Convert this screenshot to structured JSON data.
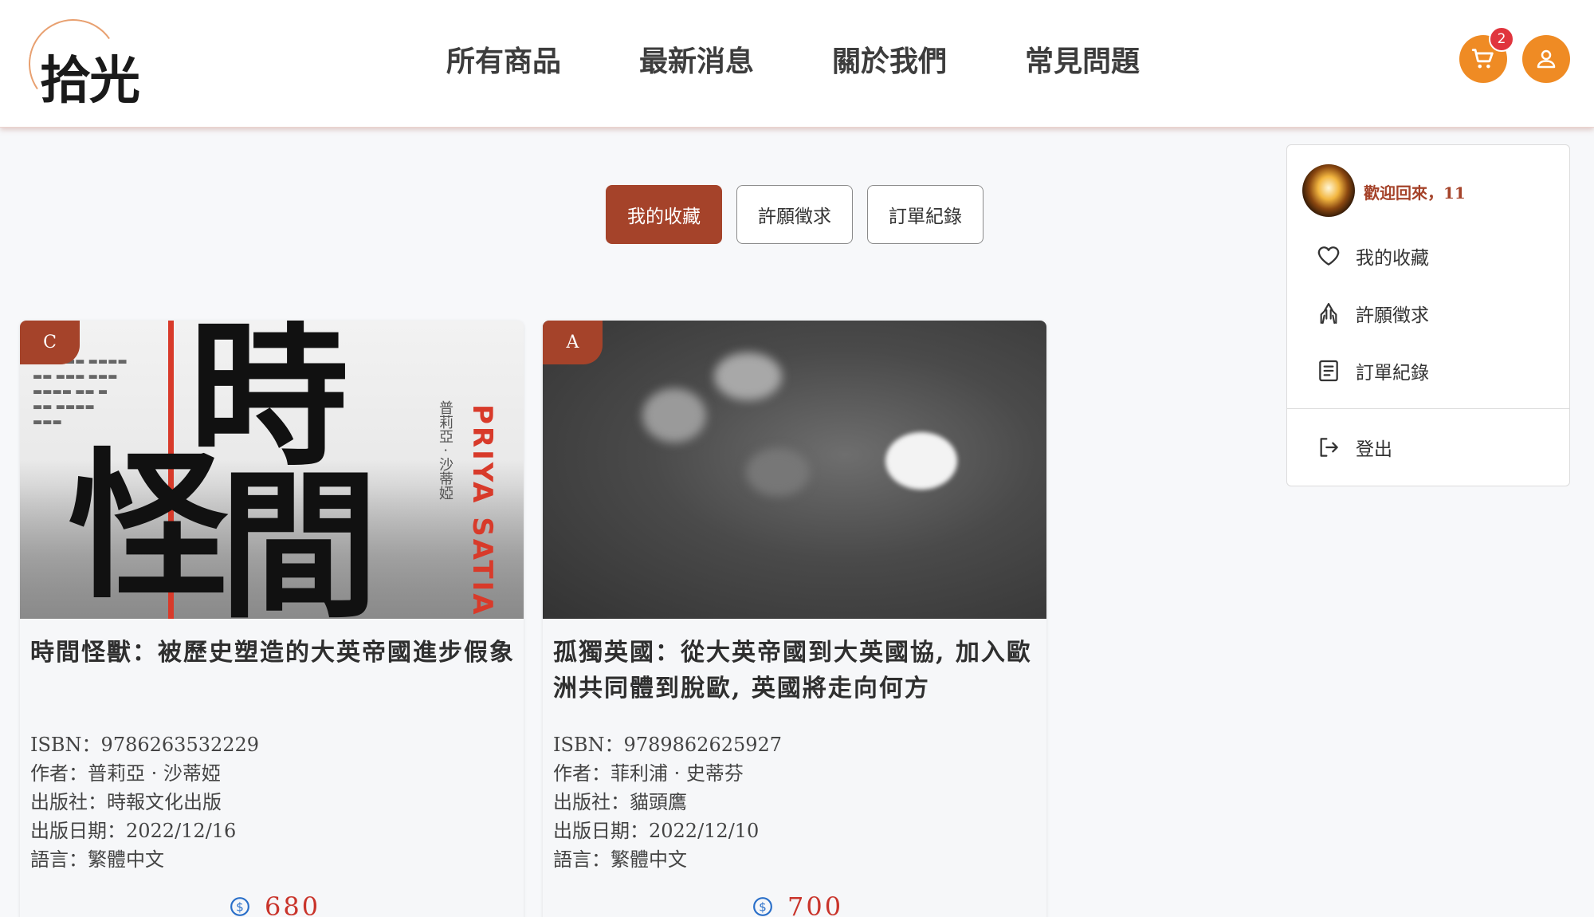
{
  "brand": {
    "logo_text": "拾光"
  },
  "nav": {
    "items": [
      "所有商品",
      "最新消息",
      "關於我們",
      "常見問題"
    ]
  },
  "cart": {
    "count": "2"
  },
  "colors": {
    "accent": "#a5432a",
    "orange": "#ef8b24",
    "badge": "#e0353d",
    "price": "#c9342b"
  },
  "tabs": [
    {
      "label": "我的收藏",
      "active": true
    },
    {
      "label": "許願徵求",
      "active": false
    },
    {
      "label": "訂單紀錄",
      "active": false
    }
  ],
  "products": [
    {
      "grade": "C",
      "title": "時間怪獸：被歷史塑造的大英帝國進步假象",
      "isbn": "ISBN：9786263532229",
      "author": "作者：普莉亞 · 沙蒂婭",
      "publisher": "出版社：時報文化出版",
      "date": "出版日期：2022/12/16",
      "language": "語言：繁體中文",
      "price": "680",
      "cover": {
        "big_chars": [
          "時",
          "怪",
          "間"
        ],
        "side_text": "PRIYA SATIA",
        "author_vertical": "普莉亞 · 沙蒂婭"
      }
    },
    {
      "grade": "A",
      "title": "孤獨英國：從大英帝國到大英國協, 加入歐洲共同體到脫歐, 英國將走向何方",
      "isbn": "ISBN：9789862625927",
      "author": "作者：菲利浦 · 史蒂芬",
      "publisher": "出版社：貓頭鷹",
      "date": "出版日期：2022/12/10",
      "language": "語言：繁體中文",
      "price": "700"
    }
  ],
  "dropdown": {
    "welcome": "歡迎回來，11",
    "items": [
      {
        "label": "我的收藏",
        "icon": "heart-icon"
      },
      {
        "label": "許願徵求",
        "icon": "praying-hands-icon"
      },
      {
        "label": "訂單紀錄",
        "icon": "document-icon"
      }
    ],
    "logout": {
      "label": "登出",
      "icon": "logout-icon"
    }
  }
}
